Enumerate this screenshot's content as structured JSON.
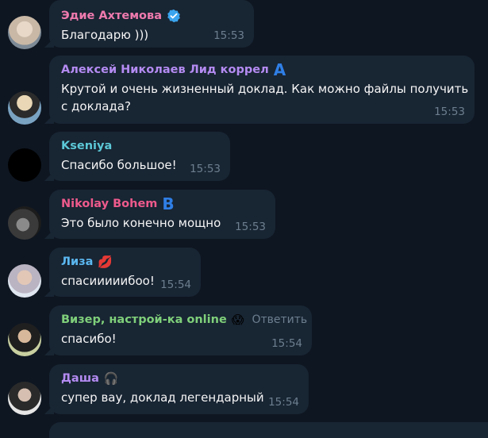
{
  "messages": [
    {
      "author": "Эдие Ахтемова",
      "author_color": "#ee7aae",
      "text": "Благодарю )))",
      "time": "15:53",
      "badge": "verified-icon"
    },
    {
      "author": "Алексей Николаев Лид коррел",
      "author_color": "#b48bf2",
      "text_line1": "Крутой и очень жизненный доклад. Как можно файлы получить",
      "text_line2": "с доклада?",
      "time": "15:53",
      "badge": "letter-a-icon",
      "badge_text": "A"
    },
    {
      "author": "Kseniya",
      "author_color": "#5cc8d7",
      "text": "Спасибо большое!",
      "time": "15:53"
    },
    {
      "author": "Nikolay Bohem",
      "author_color": "#ee5a8c",
      "text": "Это было конечно мощно",
      "time": "15:53",
      "badge": "letter-b-icon",
      "badge_text": "B"
    },
    {
      "author": "Лиза",
      "author_color": "#5bb8f0",
      "text": "спасииииибоо!",
      "time": "15:54",
      "badge": "kiss-mark-icon",
      "badge_text": "💋"
    },
    {
      "author": "Визер, настрой-ка online",
      "author_color": "#7fcf7a",
      "reply_label": "Ответить",
      "text": "спасибо!",
      "time": "15:54",
      "badge": "custom-emoji-icon",
      "badge_text": "😱"
    },
    {
      "author": "Даша",
      "author_color": "#b48bf2",
      "text": "супер вау, доклад легендарный",
      "time": "15:54",
      "badge": "headphones-emoji-icon",
      "badge_text": "🎧"
    }
  ]
}
